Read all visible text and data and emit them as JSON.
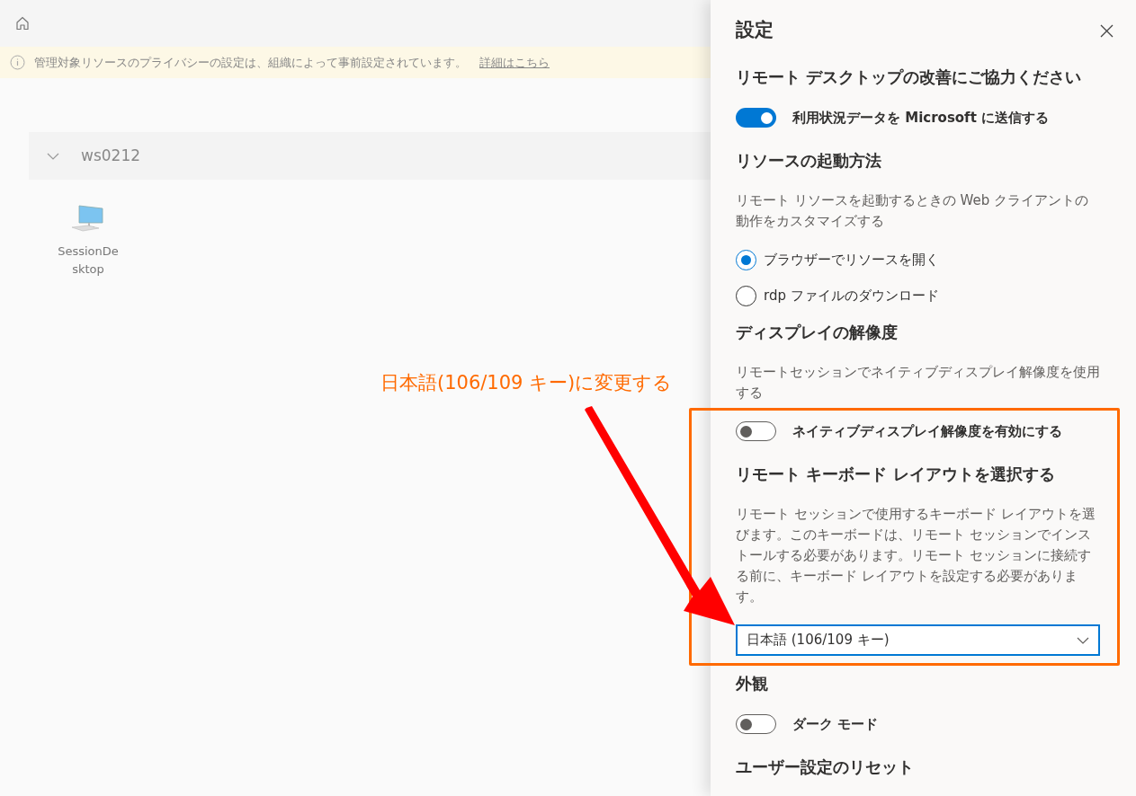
{
  "banner": {
    "message": "管理対象リソースのプライバシーの設定は、組織によって事前設定されています。",
    "link": "詳細はこちら"
  },
  "group": {
    "name": "ws0212",
    "expanded": true,
    "resources": [
      {
        "label": "SessionDesktop"
      }
    ]
  },
  "settings": {
    "title": "設定",
    "items": [
      {
        "kind": "heading",
        "text": "リモート デスクトップの改善にご協力ください",
        "highlighted": false
      },
      {
        "kind": "toggle",
        "label": "利用状況データを Microsoft に送信する",
        "on": true,
        "highlighted": false
      },
      {
        "kind": "heading",
        "text": "リソースの起動方法",
        "highlighted": false
      },
      {
        "kind": "description",
        "text": "リモート リソースを起動するときの Web クライアントの動作をカスタマイズする",
        "highlighted": false
      },
      {
        "kind": "radio",
        "label": "ブラウザーでリソースを開く",
        "selected": true,
        "highlighted": false
      },
      {
        "kind": "radio",
        "label": "rdp ファイルのダウンロード",
        "selected": false,
        "highlighted": false
      },
      {
        "kind": "heading",
        "text": "ディスプレイの解像度",
        "highlighted": false
      },
      {
        "kind": "description",
        "text": "リモートセッションでネイティブディスプレイ解像度を使用する",
        "highlighted": false
      },
      {
        "kind": "toggle",
        "label": "ネイティブディスプレイ解像度を有効にする",
        "on": false,
        "highlighted": true
      },
      {
        "kind": "heading",
        "text": "リモート キーボード レイアウトを選択する",
        "highlighted": true
      },
      {
        "kind": "description",
        "text": "リモート セッションで使用するキーボード レイアウトを選びます。このキーボードは、リモート セッションでインストールする必要があります。リモート セッションに接続する前に、キーボード レイアウトを設定する必要があります。",
        "highlighted": true
      },
      {
        "kind": "dropdown",
        "value": "日本語 (106/109 キー)",
        "highlighted": true
      },
      {
        "kind": "heading",
        "text": "外観",
        "highlighted": false
      },
      {
        "kind": "toggle",
        "label": "ダーク モード",
        "on": false,
        "highlighted": false
      },
      {
        "kind": "heading",
        "text": "ユーザー設定のリセット",
        "highlighted": false
      }
    ]
  },
  "annotation": {
    "callout": "日本語(106/109 キー)に変更する"
  }
}
